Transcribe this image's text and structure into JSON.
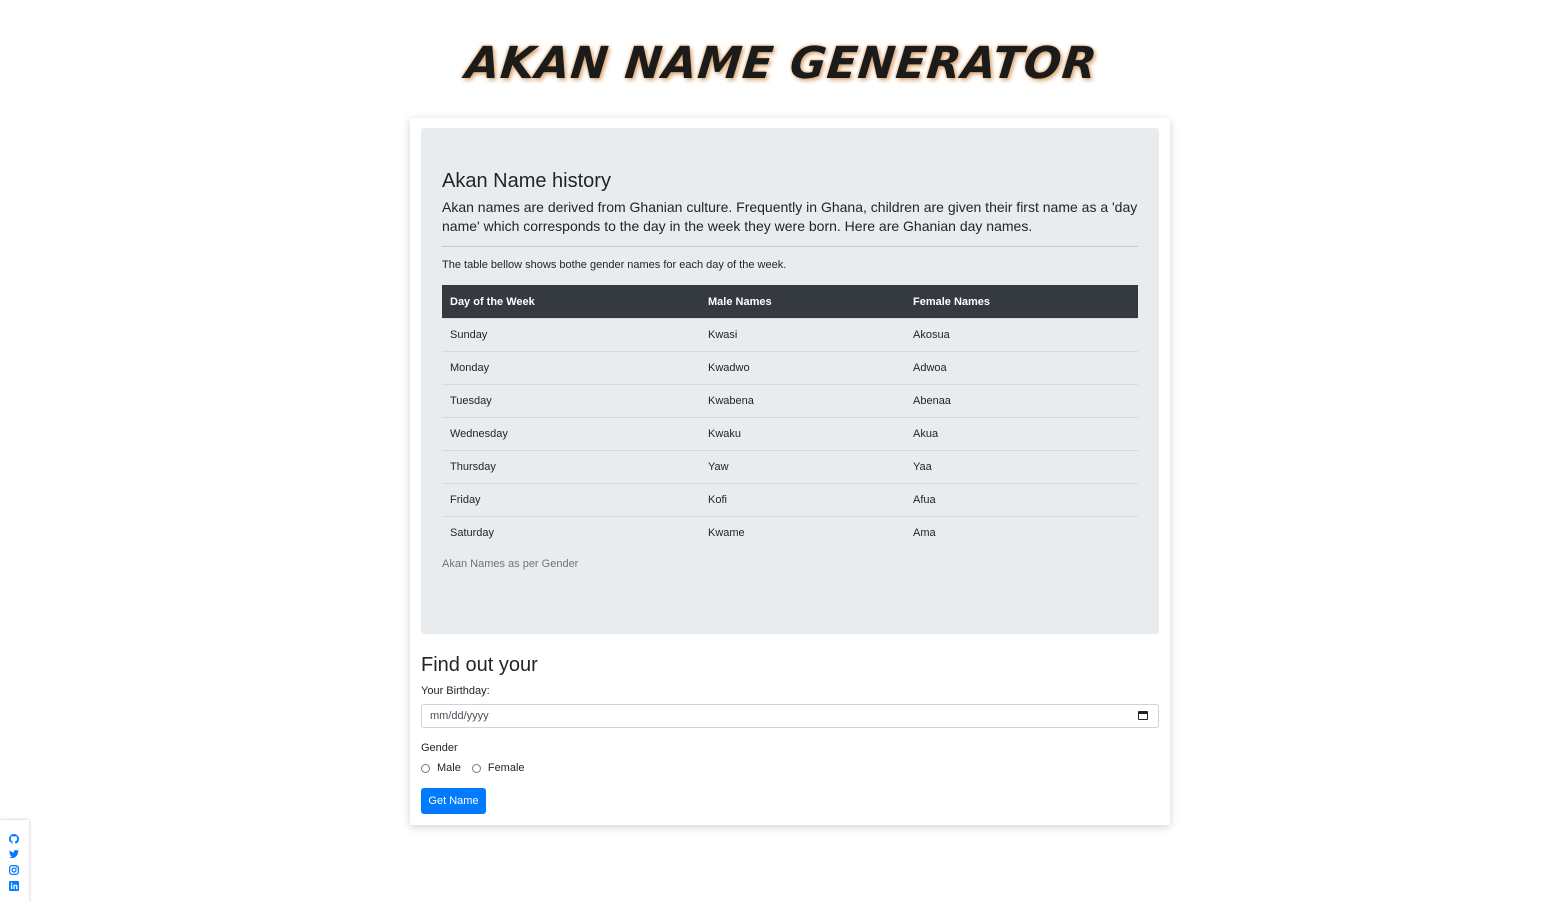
{
  "header": {
    "title": "AKAN NAME GENERATOR"
  },
  "history": {
    "title": "Akan Name history",
    "text": "Akan names are derived from Ghanian culture. Frequently in Ghana, children are given their first name as a 'day name' which corresponds to the day in the week they were born. Here are Ghanian day names.",
    "table_intro": "The table bellow shows bothe gender names for each day of the week.",
    "caption": "Akan Names as per Gender"
  },
  "table": {
    "headers": [
      "Day of the Week",
      "Male Names",
      "Female Names"
    ],
    "rows": [
      [
        "Sunday",
        "Kwasi",
        "Akosua"
      ],
      [
        "Monday",
        "Kwadwo",
        "Adwoa"
      ],
      [
        "Tuesday",
        "Kwabena",
        "Abenaa"
      ],
      [
        "Wednesday",
        "Kwaku",
        "Akua"
      ],
      [
        "Thursday",
        "Yaw",
        "Yaa"
      ],
      [
        "Friday",
        "Kofi",
        "Afua"
      ],
      [
        "Saturday",
        "Kwame",
        "Ama"
      ]
    ]
  },
  "form": {
    "title": "Find out your",
    "birthday_label": "Your Birthday:",
    "birthday_placeholder": "mm/dd/yyyy",
    "gender_label": "Gender",
    "male_label": "Male",
    "female_label": "Female",
    "submit_label": "Get Name"
  },
  "social": {
    "icons": [
      "github-icon",
      "twitter-icon",
      "instagram-icon",
      "linkedin-icon"
    ],
    "color": "#007bff"
  },
  "colors": {
    "accent": "#007bff",
    "table_header": "#343a40",
    "jumbotron": "#e9ecef"
  }
}
